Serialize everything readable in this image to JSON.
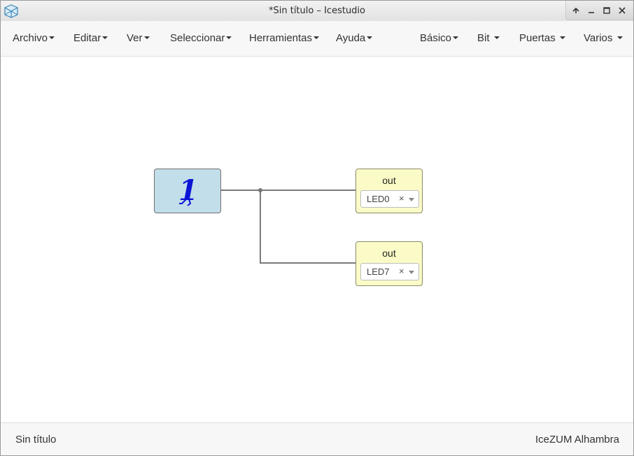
{
  "window": {
    "title": "*Sin título – Icestudio"
  },
  "menubar": {
    "left": [
      "Archivo",
      "Editar",
      "Ver",
      "Seleccionar",
      "Herramientas",
      "Ayuda"
    ],
    "right": [
      "Básico",
      "Bit",
      "Puertas",
      "Varios"
    ]
  },
  "blocks": {
    "constant": {
      "value": "1",
      "color": "#c1deea"
    },
    "outputs": [
      {
        "label": "out",
        "pin": "LED0",
        "clear": "×"
      },
      {
        "label": "out",
        "pin": "LED7",
        "clear": "×"
      }
    ]
  },
  "statusbar": {
    "left": "Sin título",
    "right": "IceZUM Alhambra"
  }
}
